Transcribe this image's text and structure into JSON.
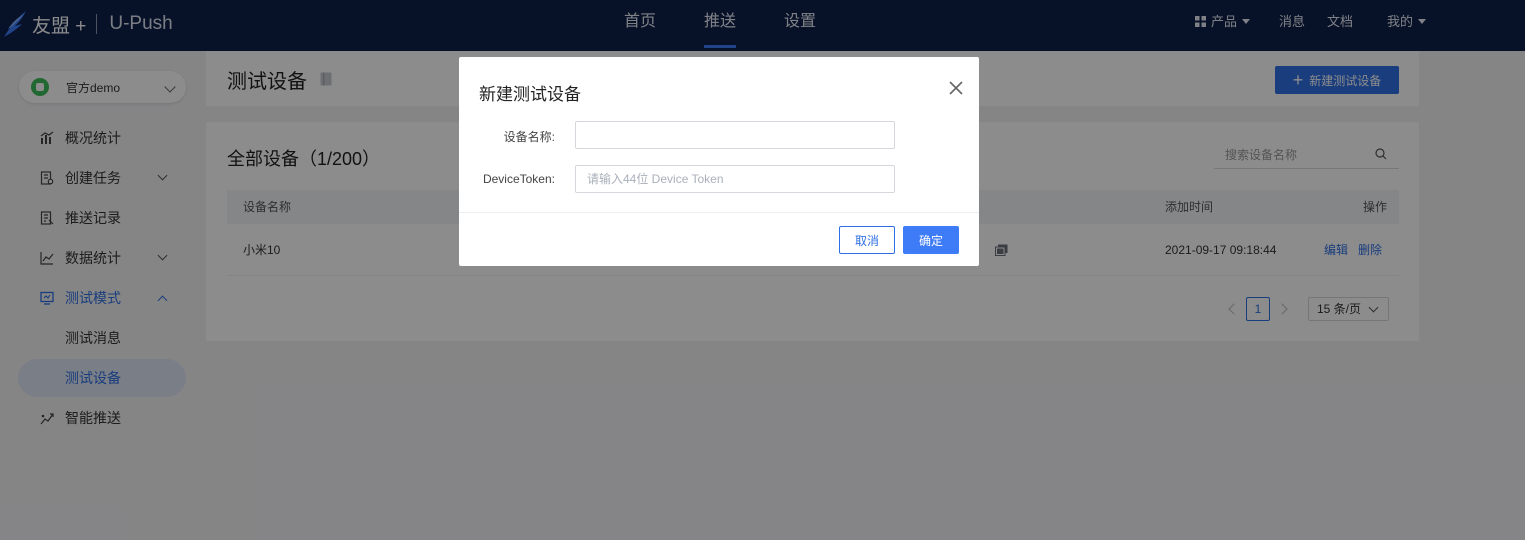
{
  "brand": {
    "logo_text": "友盟 +",
    "product": "U-Push"
  },
  "main_nav": [
    {
      "label": "首页"
    },
    {
      "label": "推送",
      "active": true
    },
    {
      "label": "设置"
    }
  ],
  "right_nav": {
    "products": "产品",
    "messages": "消息",
    "docs": "文档",
    "me": "我的"
  },
  "sidebar": {
    "app_name": "官方demo",
    "items": [
      {
        "label": "概况统计",
        "icon": "overview-chart-icon"
      },
      {
        "label": "创建任务",
        "icon": "create-task-icon",
        "expandable": true
      },
      {
        "label": "推送记录",
        "icon": "push-record-icon"
      },
      {
        "label": "数据统计",
        "icon": "line-chart-icon",
        "expandable": true
      },
      {
        "label": "测试模式",
        "icon": "monitor-icon",
        "expandable": true,
        "open": true
      },
      {
        "label": "智能推送",
        "icon": "smart-push-icon"
      }
    ],
    "sub_items": [
      {
        "label": "测试消息"
      },
      {
        "label": "测试设备",
        "selected": true
      }
    ]
  },
  "page": {
    "title": "测试设备",
    "new_button": "新建测试设备"
  },
  "device_list": {
    "title": "全部设备（1/200）",
    "search_placeholder": "搜索设备名称",
    "columns": {
      "name": "设备名称",
      "added_time": "添加时间",
      "actions": "操作"
    },
    "rows": [
      {
        "name": "小米10",
        "added_time": "2021-09-17 09:18:44",
        "edit": "编辑",
        "delete": "删除"
      }
    ],
    "pagination": {
      "current_page": "1",
      "page_size": "15 条/页"
    }
  },
  "modal": {
    "title": "新建测试设备",
    "name_label": "设备名称:",
    "name_value": "",
    "token_label": "DeviceToken:",
    "token_placeholder": "请输入44位 Device Token",
    "cancel": "取消",
    "confirm": "确定"
  },
  "colors": {
    "topbar": "#0d1f4a",
    "accent": "#2f6fe4",
    "confirm_button": "#3d7bf7",
    "background": "#f2f3f5"
  }
}
